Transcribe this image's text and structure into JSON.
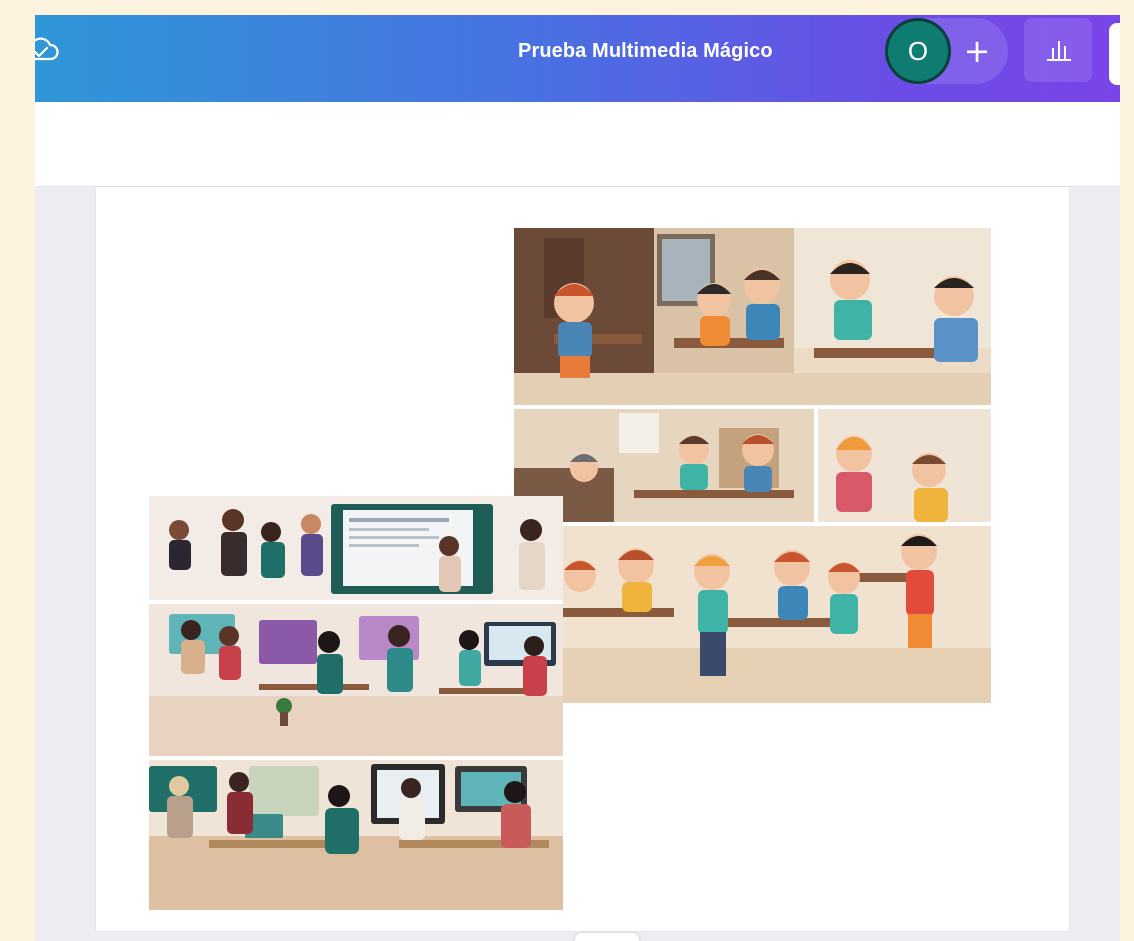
{
  "topbar": {
    "title": "Prueba Multimedia Mágico",
    "icons": {
      "save_status": "cloud-check-icon",
      "add_collaborator": "plus-icon",
      "insights": "bar-chart-icon"
    },
    "avatar": {
      "initial": "O",
      "color": "#0f7c72"
    },
    "add_label": "+",
    "gradient_colors": [
      "#2f97d8",
      "#6b4ce6"
    ]
  },
  "canvas": {
    "background": "#edeef2",
    "page_background": "#ffffff",
    "images": [
      {
        "name": "children-classroom-collage",
        "panels": 4
      },
      {
        "name": "teachers-meeting-collage",
        "panels": 3
      }
    ]
  }
}
